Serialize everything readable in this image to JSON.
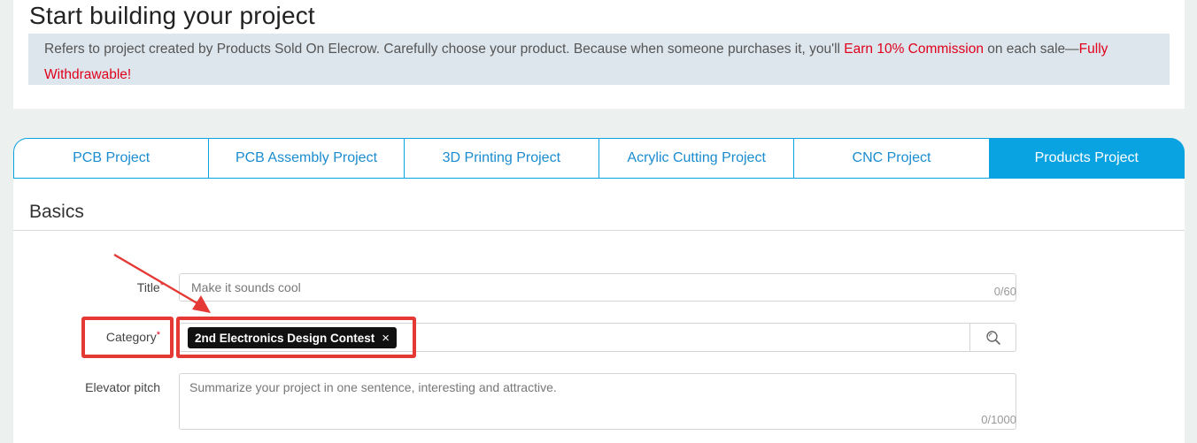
{
  "header": {
    "title": "Start building your project",
    "notice_part1": "Refers to project created by Products Sold On Elecrow. Carefully choose your product. Because when someone purchases it, you'll ",
    "notice_highlight1": "Earn 10% Commission",
    "notice_part2": " on each sale—",
    "notice_highlight2": "Fully Withdrawable!"
  },
  "tabs": [
    {
      "label": "PCB Project",
      "active": false
    },
    {
      "label": "PCB Assembly Project",
      "active": false
    },
    {
      "label": "3D Printing Project",
      "active": false
    },
    {
      "label": "Acrylic Cutting Project",
      "active": false
    },
    {
      "label": "CNC Project",
      "active": false
    },
    {
      "label": "Products Project",
      "active": true
    }
  ],
  "basics": {
    "section_title": "Basics",
    "title_field": {
      "label": "Title",
      "required_mark": "*",
      "placeholder": "Make it sounds cool",
      "counter": "0/60"
    },
    "category_field": {
      "label": "Category",
      "required_mark": "*",
      "tag": "2nd Electronics Design Contest",
      "tag_close": "×"
    },
    "pitch_field": {
      "label": "Elevator pitch",
      "placeholder": "Summarize your project in one sentence, interesting and attractive.",
      "counter": "0/1000"
    }
  },
  "colors": {
    "accent": "#0aa3e2",
    "highlight_red": "#e53935",
    "commission_red": "#e0001b"
  },
  "icons": {
    "search": "search-icon",
    "close": "close-icon"
  }
}
